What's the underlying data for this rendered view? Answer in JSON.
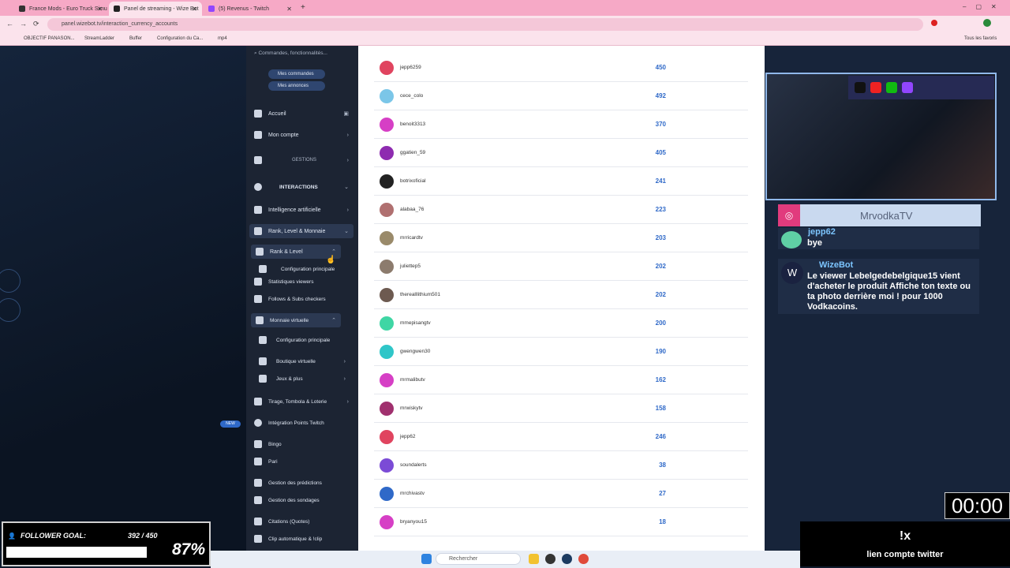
{
  "browser": {
    "tabs": [
      {
        "label": "France Mods - Euro Truck Simu"
      },
      {
        "label": "Panel de streaming - Wize Bot"
      },
      {
        "label": "(5) Revenus - Twitch"
      }
    ],
    "url": "panel.wizebot.tv/interaction_currency_accounts",
    "bookmarks": [
      "OBJECTIF PANASON...",
      "StreamLadder",
      "Buffer",
      "Configuration du Ca...",
      "mp4"
    ],
    "bookmarks_right": "Tous les favoris"
  },
  "sidebar": {
    "search_placeholder": "Commandes, fonctionnalités...",
    "mes_commandes": "Mes commandes",
    "mes_annonces": "Mes annonces",
    "items": [
      {
        "label": "Accueil"
      },
      {
        "label": "Mon compte"
      },
      {
        "label": "GESTIONS"
      },
      {
        "label": "INTERACTIONS"
      },
      {
        "label": "Intelligence artificielle"
      },
      {
        "label": "Rank, Level & Monnaie"
      },
      {
        "label": "Rank & Level"
      },
      {
        "label": "Configuration principale"
      },
      {
        "label": "Statistiques viewers"
      },
      {
        "label": "Follows & Subs checkers"
      },
      {
        "label": "Monnaie virtuelle"
      },
      {
        "label": "Configuration principale"
      },
      {
        "label": "Boutique virtuelle"
      },
      {
        "label": "Jeux & plus"
      },
      {
        "label": "Tirage, Tombola & Loterie"
      },
      {
        "label": "Intégration Points Twitch"
      },
      {
        "label": "Bingo"
      },
      {
        "label": "Pari"
      },
      {
        "label": "Gestion des prédictions"
      },
      {
        "label": "Gestion des sondages"
      },
      {
        "label": "Citations (Quotes)"
      },
      {
        "label": "Clip automatique & !clip"
      }
    ],
    "new_badge": "NEW"
  },
  "accounts": [
    {
      "name": "jepp6259",
      "value": "450",
      "color": "#e0445f"
    },
    {
      "name": "cece_colo",
      "value": "492",
      "color": "#7bc6e8"
    },
    {
      "name": "benoit3313",
      "value": "370",
      "color": "#d63fc5"
    },
    {
      "name": "ggatien_59",
      "value": "405",
      "color": "#8e2bb0"
    },
    {
      "name": "botrixoficial",
      "value": "241",
      "color": "#222222"
    },
    {
      "name": "alabaa_76",
      "value": "223",
      "color": "#b07070"
    },
    {
      "name": "mrricardtv",
      "value": "203",
      "color": "#9a8a6a"
    },
    {
      "name": "juliettep5",
      "value": "202",
      "color": "#8c7b6d"
    },
    {
      "name": "therealllithium501",
      "value": "202",
      "color": "#6d5a50"
    },
    {
      "name": "mmepisangtv",
      "value": "200",
      "color": "#3fd6a4"
    },
    {
      "name": "gwengwen30",
      "value": "190",
      "color": "#2fc6c8"
    },
    {
      "name": "mrmalibutv",
      "value": "162",
      "color": "#d63fc5"
    },
    {
      "name": "mrwiskytv",
      "value": "158",
      "color": "#a0306e"
    },
    {
      "name": "jepp62",
      "value": "246",
      "color": "#e0445f"
    },
    {
      "name": "soundalerts",
      "value": "38",
      "color": "#7b4bd6"
    },
    {
      "name": "mrchivastv",
      "value": "27",
      "color": "#2f69c8"
    },
    {
      "name": "bryanyou15",
      "value": "18",
      "color": "#d63fc5"
    }
  ],
  "stream": {
    "channel_name": "MrvodkaTV",
    "chat": [
      {
        "user": "jepp62",
        "message": "bye"
      },
      {
        "user": "WizeBot",
        "message": "Le viewer Lebelgedebelgique15 vient d'acheter le produit  Affiche ton texte ou ta photo derrière moi ! pour 1000 Vodkacoins."
      }
    ],
    "follower_goal_label": "FOLLOWER GOAL:",
    "follower_goal_count": "392 / 450",
    "follower_goal_percent": "87%",
    "follower_goal_fraction": 0.87,
    "timer": "00:00",
    "command": "!x",
    "command_desc": "lien compte twitter"
  },
  "taskbar": {
    "search_placeholder": "Rechercher"
  }
}
